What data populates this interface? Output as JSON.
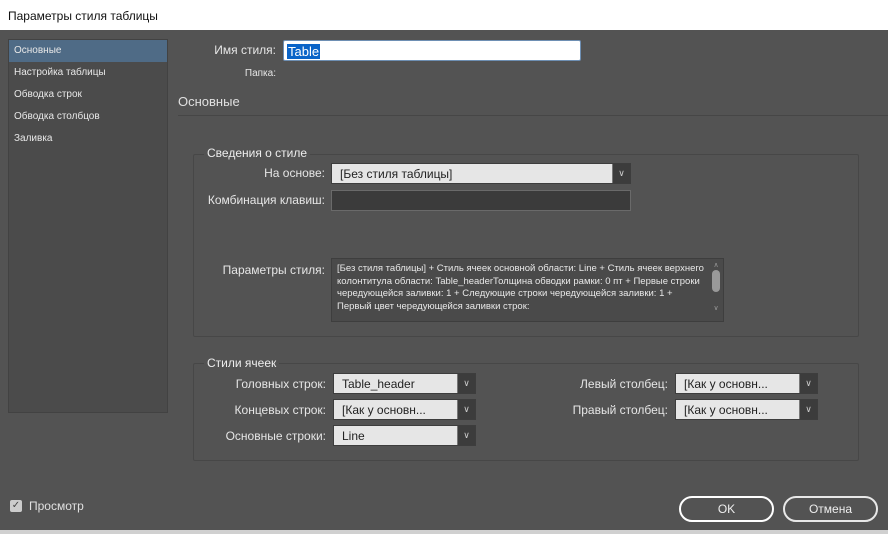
{
  "window": {
    "title": "Параметры стиля таблицы"
  },
  "sidebar": {
    "items": [
      {
        "label": "Основные",
        "selected": true
      },
      {
        "label": "Настройка таблицы"
      },
      {
        "label": "Обводка строк"
      },
      {
        "label": "Обводка столбцов"
      },
      {
        "label": "Заливка"
      }
    ]
  },
  "header": {
    "name_label": "Имя стиля:",
    "name_value": "Table",
    "folder_label": "Папка:",
    "section_title": "Основные"
  },
  "style_info": {
    "group_label": "Сведения о стиле",
    "based_on_label": "На основе:",
    "based_on_value": "[Без стиля таблицы]",
    "shortcut_label": "Комбинация клавиш:",
    "shortcut_value": "",
    "params_label": "Параметры стиля:",
    "params_text": "[Без стиля таблицы] + Стиль ячеек основной области: Line + Стиль ячеек верхнего колонтитула области: Table_headerТолщина обводки рамки: 0 пт + Первые строки чередующейся заливки: 1 + Следующие строки чередующейся заливки: 1 + Первый цвет чередующейся заливки строк:"
  },
  "cell_styles": {
    "group_label": "Стили ячеек",
    "header_rows_label": "Головных строк:",
    "header_rows_value": "Table_header",
    "footer_rows_label": "Концевых строк:",
    "footer_rows_value": "[Как у основн...",
    "body_rows_label": "Основные строки:",
    "body_rows_value": "Line",
    "left_col_label": "Левый столбец:",
    "left_col_value": "[Как у основн...",
    "right_col_label": "Правый столбец:",
    "right_col_value": "[Как у основн..."
  },
  "footer": {
    "preview_label": "Просмотр",
    "preview_checked": true,
    "ok_label": "OK",
    "cancel_label": "Отмена"
  },
  "colors": {
    "background": "#535353",
    "selection": "#4f6b86",
    "text_highlight": "#0a64c8"
  }
}
